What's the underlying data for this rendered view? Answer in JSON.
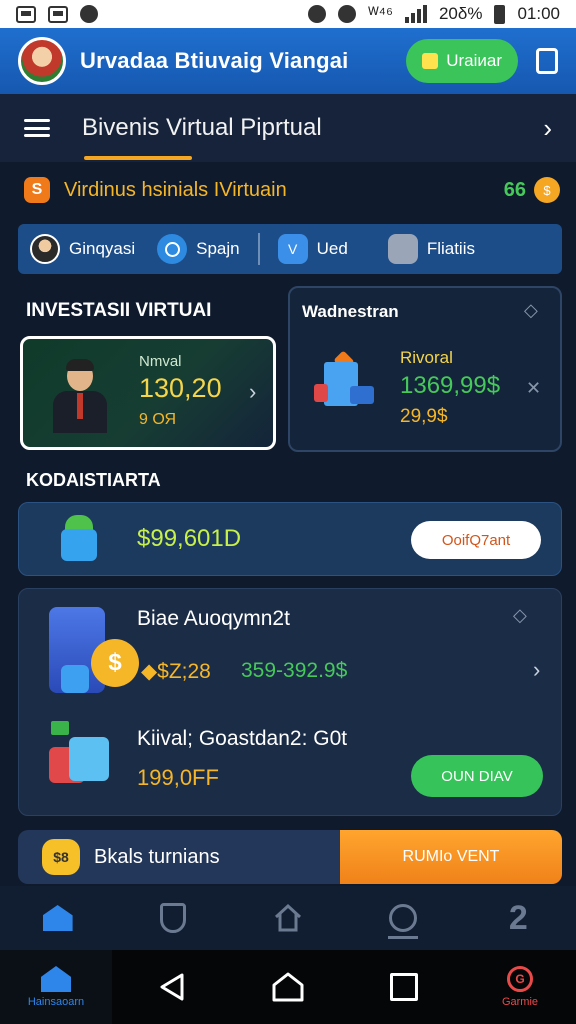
{
  "status_bar": {
    "battery": "20δ%",
    "time": "01:00",
    "signal_label": "ᵂ⁴⁶",
    "icons": [
      "image-icon",
      "gallery-icon",
      "settings-icon",
      "alarm-icon",
      "wifi-icon",
      "signal-icon",
      "battery-icon"
    ]
  },
  "header": {
    "app_title": "Urvadaa Btiuvaig Viangai",
    "wallet_label": "Uraiиar"
  },
  "title_row": {
    "title": "Bivenis Virtual Piprtual"
  },
  "notice": {
    "icon_glyph": "S",
    "text": "Virdinus hsinials IVirtuain",
    "amount": "66",
    "coin_glyph": "$"
  },
  "chips": [
    {
      "label": "Ginqyasi"
    },
    {
      "label": "Spajn"
    },
    {
      "label": "Ued",
      "glyph": "V"
    },
    {
      "label": "Fliatiis"
    }
  ],
  "sections": {
    "investasi": "INVESTASII VIRTUAI",
    "wadnestran": "Wadnestran",
    "kodaistlarta": "KODAISTIARTA"
  },
  "card_a": {
    "label": "Nmval",
    "value": "130,20",
    "sub": "9 ОЯ"
  },
  "card_b": {
    "label": "Rivoral",
    "value": "1369,99$",
    "sub": "29,9$"
  },
  "balance": {
    "value": "$99,601D",
    "button": "OoifQ7ant"
  },
  "list": {
    "item1_title": "Biae Auoqymn2t",
    "item1_sub_prefix": "◆$Z;28",
    "item1_sub_value": "359-392.9$",
    "coin_glyph": "$",
    "item2_title": "Kiival; Goastdan2: G0t",
    "item2_value": "199,0FF",
    "item2_button": "OUN DIAV"
  },
  "promo": {
    "icon_glyph": "$8",
    "text": "Bkals turnians",
    "button": "RUMIo VENT"
  },
  "nav": {
    "home_label": "Hainsaoarn",
    "game_label": "Garmie",
    "game_glyph": "G"
  },
  "colors": {
    "header_blue": "#1f6fcf",
    "accent_orange": "#f5a623",
    "accent_green": "#36c35a",
    "page_bg": "#0f1a2c"
  }
}
